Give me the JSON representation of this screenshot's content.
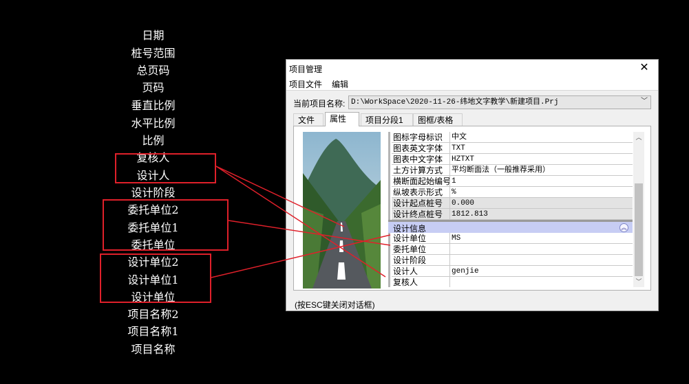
{
  "cad_labels": [
    "日期",
    "桩号范围",
    "总页码",
    "页码",
    "垂直比例",
    "水平比例",
    "比例",
    "复核人",
    "设计人",
    "设计阶段",
    "委托单位2",
    "委托单位1",
    "委托单位",
    "设计单位2",
    "设计单位1",
    "设计单位",
    "项目名称2",
    "项目名称1",
    "项目名称"
  ],
  "colors": {
    "annotation": "#e0202a",
    "group_header": "#c7cdf4",
    "background": "#000000"
  },
  "dialog": {
    "title": "项目管理",
    "close_icon": "close-icon",
    "menu": [
      "项目文件",
      "编辑"
    ],
    "project_label": "当前项目名称:",
    "project_value": "D:\\WorkSpace\\2020-11-26-纬地文字教学\\新建项目.Prj",
    "tabs": [
      "文件",
      "属性",
      "项目分段1",
      "图框/表格"
    ],
    "active_tab": "属性",
    "properties": [
      {
        "name": "图标字母标识",
        "value": "中文"
      },
      {
        "name": "图表英文字体",
        "value": "TXT"
      },
      {
        "name": "图表中文字体",
        "value": "HZTXT"
      },
      {
        "name": "土方计算方式",
        "value": "平均断面法（一般推荐采用）"
      },
      {
        "name": "横断面起始编号",
        "value": "1"
      },
      {
        "name": "纵坡表示形式",
        "value": "%"
      },
      {
        "name": "设计起点桩号",
        "value": "0.000"
      },
      {
        "name": "设计终点桩号",
        "value": "1812.813"
      }
    ],
    "group_title": "设计信息",
    "design_info": [
      {
        "name": "设计单位",
        "value": "MS"
      },
      {
        "name": "委托单位",
        "value": ""
      },
      {
        "name": "设计阶段",
        "value": ""
      },
      {
        "name": "设计人",
        "value": "genjie"
      },
      {
        "name": "复核人",
        "value": ""
      }
    ],
    "status": "(按ESC键关闭对话框)"
  }
}
